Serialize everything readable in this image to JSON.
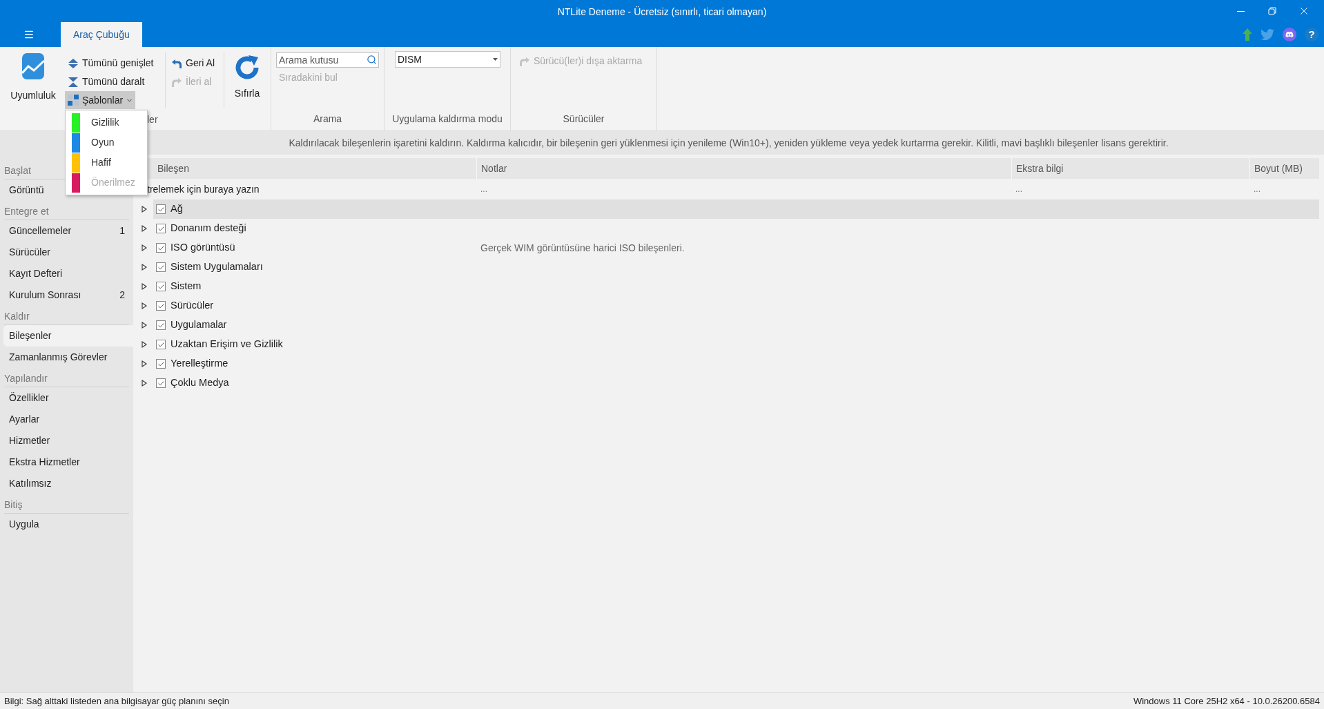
{
  "window": {
    "title": "NTLite Deneme - Ücretsiz (sınırlı, ticari olmayan)"
  },
  "help_icon": "?",
  "tabs": [
    {
      "label": "Araç Çubuğu",
      "selected": true
    }
  ],
  "ribbon": {
    "compatibility": "Uyumluluk",
    "expand_all": "Tümünü genişlet",
    "collapse_all": "Tümünü daralt",
    "templates": {
      "label": "Şablonlar",
      "expanded": true
    },
    "undo": {
      "label": "Geri Al",
      "disabled": false
    },
    "redo": {
      "label": "İleri al",
      "disabled": true
    },
    "reset": "Sıfırla",
    "search": {
      "placeholder": "Arama kutusu"
    },
    "find_next": {
      "label": "Sıradakini bul",
      "disabled": true
    },
    "removal_mode": {
      "value": "DISM"
    },
    "export_drivers": {
      "label": "Sürücü(ler)i dışa aktarma",
      "disabled": true
    },
    "group_labels": [
      "ler",
      "Arama",
      "Uygulama kaldırma modu",
      "Sürücüler"
    ]
  },
  "templates_menu": [
    {
      "label": "Gizlilik",
      "color": "#27f227",
      "disabled": false
    },
    {
      "label": "Oyun",
      "color": "#1e88e5",
      "disabled": false
    },
    {
      "label": "Hafif",
      "color": "#ffc107",
      "disabled": false
    },
    {
      "label": "Önerilmez",
      "color": "#d81b60",
      "disabled": true
    }
  ],
  "info": "Kaldırılacak bileşenlerin işaretini kaldırın. Kaldırma kalıcıdır, bir bileşenin geri yüklenmesi için yenileme (Win10+), yeniden yükleme veya yedek kurtarma gerekir. Kilitli, mavi başlıklı bileşenler lisans gerektirir.",
  "sidebar": [
    {
      "header": "Başlat",
      "items": [
        {
          "label": "Görüntü",
          "selected": false
        }
      ]
    },
    {
      "header": "Entegre et",
      "items": [
        {
          "label": "Güncellemeler",
          "count": "1",
          "selected": false
        },
        {
          "label": "Sürücüler",
          "selected": false
        },
        {
          "label": "Kayıt Defteri",
          "selected": false
        },
        {
          "label": "Kurulum Sonrası",
          "count": "2",
          "selected": false
        }
      ]
    },
    {
      "header": "Kaldır",
      "items": [
        {
          "label": "Bileşenler",
          "selected": true
        },
        {
          "label": "Zamanlanmış Görevler",
          "selected": false
        }
      ]
    },
    {
      "header": "Yapılandır",
      "items": [
        {
          "label": "Özellikler",
          "selected": false
        },
        {
          "label": "Ayarlar",
          "selected": false
        },
        {
          "label": "Hizmetler",
          "selected": false
        },
        {
          "label": "Ekstra Hizmetler",
          "selected": false
        },
        {
          "label": "Katılımsız",
          "selected": false
        }
      ]
    },
    {
      "header": "Bitiş",
      "items": [
        {
          "label": "Uygula",
          "selected": false
        }
      ]
    }
  ],
  "table": {
    "columns": [
      "Bileşen",
      "Notlar",
      "Ekstra bilgi",
      "Boyut (MB)"
    ],
    "filter": [
      "trelemek için buraya yazın",
      "...",
      "...",
      "..."
    ],
    "rows": [
      {
        "label": "Ağ",
        "checked": true,
        "selected": true
      },
      {
        "label": "Donanım desteği",
        "checked": true,
        "selected": false
      },
      {
        "label": "ISO görüntüsü",
        "checked": true,
        "selected": false,
        "note": "Gerçek WIM görüntüsüne harici ISO bileşenleri."
      },
      {
        "label": "Sistem Uygulamaları",
        "checked": true,
        "selected": false
      },
      {
        "label": "Sistem",
        "checked": true,
        "selected": false
      },
      {
        "label": "Sürücüler",
        "checked": true,
        "selected": false
      },
      {
        "label": "Uygulamalar",
        "checked": true,
        "selected": false
      },
      {
        "label": "Uzaktan Erişim ve Gizlilik",
        "checked": true,
        "selected": false
      },
      {
        "label": "Yerelleştirme",
        "checked": true,
        "selected": false
      },
      {
        "label": "Çoklu Medya",
        "checked": true,
        "selected": false
      }
    ]
  },
  "status_bar": {
    "left": "Bilgi: Sağ alttaki listeden ana bilgisayar güç planını seçin",
    "right": "Windows 11 Core 25H2 x64 - 10.0.26200.6584"
  }
}
